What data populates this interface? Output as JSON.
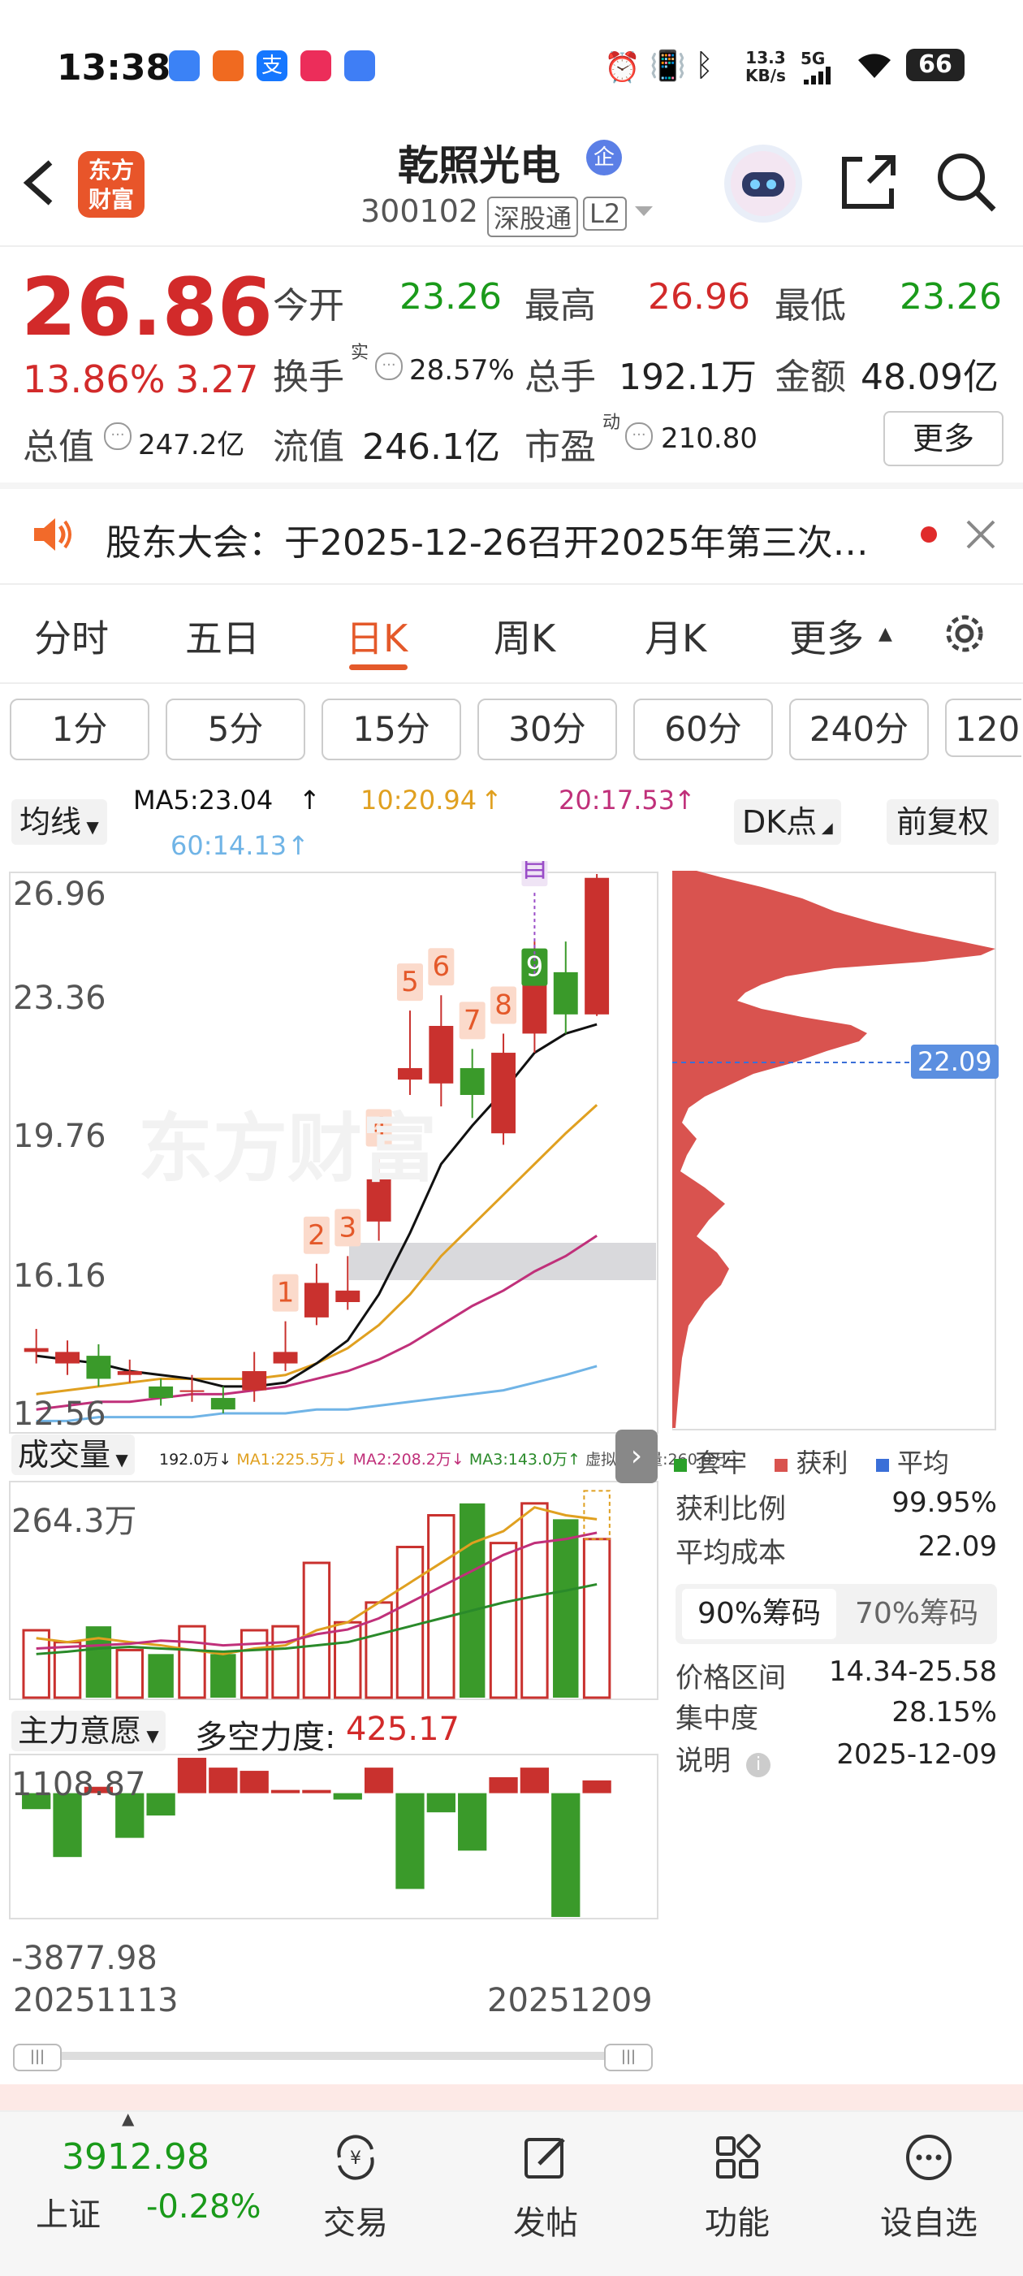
{
  "status": {
    "time": "13:38",
    "net_speed_top": "13.3",
    "net_speed_unit": "KB/s",
    "signal": "5G",
    "battery": "66",
    "app_icons": [
      "app-icon-blue",
      "app-icon-orange",
      "alipay-icon",
      "app-icon-pink",
      "app-icon-blue-q"
    ]
  },
  "header": {
    "back_icon": "chevron-left-icon",
    "brand_line1": "东方",
    "brand_line2": "财富",
    "title": "乾照光电",
    "title_badge": "企",
    "code": "300102",
    "market_tag": "深股通",
    "level_tag": "L2",
    "share_icon": "share-icon",
    "search_icon": "search-icon"
  },
  "quote": {
    "price": "26.86",
    "change_pct": "13.86%",
    "change_amt": "3.27",
    "open_label": "今开",
    "open": "23.26",
    "high_label": "最高",
    "high": "26.96",
    "low_label": "最低",
    "low": "23.26",
    "turnover_label": "换手",
    "turnover_sup": "实",
    "turnover": "28.57%",
    "volume_label": "总手",
    "volume": "192.1万",
    "amount_label": "金额",
    "amount": "48.09亿",
    "mktcap_label": "总值",
    "mktcap": "247.2亿",
    "float_label": "流值",
    "float": "246.1亿",
    "pe_label": "市盈",
    "pe_sup": "动",
    "pe": "210.80",
    "more_button": "更多"
  },
  "notice": {
    "text": "股东大会：于2025-12-26召开2025年第三次…"
  },
  "tabs": [
    "分时",
    "五日",
    "日K",
    "周K",
    "月K",
    "更多"
  ],
  "active_tab": "日K",
  "intervals": [
    "1分",
    "5分",
    "15分",
    "30分",
    "60分",
    "240分",
    "120"
  ],
  "ma_bar": {
    "selector": "均线",
    "ma5": "MA5:23.04",
    "ma10": "10:20.94",
    "ma20": "20:17.53",
    "ma60": "60:14.13",
    "dk_button": "DK点",
    "adjust_button": "前复权",
    "colors": {
      "ma5": "#111111",
      "ma10": "#e0a020",
      "ma20": "#c0307a",
      "ma60": "#70b4e6"
    }
  },
  "price_axis": [
    "26.96",
    "23.36",
    "19.76",
    "16.16",
    "12.56"
  ],
  "chip_marker": "22.09",
  "watermark": "东方财富",
  "chart_data": {
    "type": "candlestick",
    "date_range": [
      "20251113",
      "20251209"
    ],
    "ylim": [
      12.56,
      26.96
    ],
    "candles": [
      {
        "o": 14.5,
        "c": 14.6,
        "h": 15.1,
        "l": 14.2
      },
      {
        "o": 14.2,
        "c": 14.5,
        "h": 14.8,
        "l": 13.9
      },
      {
        "o": 14.4,
        "c": 13.8,
        "h": 14.7,
        "l": 13.6
      },
      {
        "o": 13.9,
        "c": 14.0,
        "h": 14.3,
        "l": 13.7
      },
      {
        "o": 13.6,
        "c": 13.3,
        "h": 13.8,
        "l": 13.1
      },
      {
        "o": 13.5,
        "c": 13.5,
        "h": 13.9,
        "l": 13.2
      },
      {
        "o": 13.3,
        "c": 13.0,
        "h": 13.6,
        "l": 12.9
      },
      {
        "o": 13.5,
        "c": 14.0,
        "h": 14.5,
        "l": 13.2
      },
      {
        "o": 14.2,
        "c": 14.5,
        "h": 15.3,
        "l": 14.0
      },
      {
        "o": 15.4,
        "c": 16.3,
        "h": 16.8,
        "l": 15.2
      },
      {
        "o": 15.8,
        "c": 16.1,
        "h": 17.0,
        "l": 15.6
      },
      {
        "o": 17.9,
        "c": 19.0,
        "h": 19.6,
        "l": 17.4
      },
      {
        "o": 21.6,
        "c": 21.9,
        "h": 23.4,
        "l": 21.2
      },
      {
        "o": 21.5,
        "c": 23.0,
        "h": 23.8,
        "l": 20.9
      },
      {
        "o": 21.9,
        "c": 21.2,
        "h": 22.4,
        "l": 20.6
      },
      {
        "o": 20.2,
        "c": 22.3,
        "h": 22.8,
        "l": 19.9
      },
      {
        "o": 22.8,
        "c": 24.3,
        "h": 25.2,
        "l": 22.3
      },
      {
        "o": 24.4,
        "c": 23.3,
        "h": 25.2,
        "l": 22.8
      },
      {
        "o": 23.3,
        "c": 26.86,
        "h": 26.96,
        "l": 23.26
      }
    ],
    "labels": [
      {
        "i": 8,
        "t": "1"
      },
      {
        "i": 9,
        "t": "2"
      },
      {
        "i": 10,
        "t": "3"
      },
      {
        "i": 11,
        "t": "4"
      },
      {
        "i": 12,
        "t": "5"
      },
      {
        "i": 13,
        "t": "6"
      },
      {
        "i": 14,
        "t": "7"
      },
      {
        "i": 15,
        "t": "8"
      },
      {
        "i": 16,
        "t": "9",
        "green": true
      },
      {
        "i": 16,
        "t": "自",
        "purple": true
      }
    ],
    "ma5": [
      14.4,
      14.3,
      14.2,
      14.0,
      13.9,
      13.8,
      13.6,
      13.6,
      13.7,
      14.2,
      14.8,
      16.0,
      17.6,
      19.4,
      20.4,
      21.3,
      22.3,
      22.8,
      23.04
    ],
    "ma10": [
      13.4,
      13.5,
      13.6,
      13.7,
      13.8,
      13.8,
      13.8,
      13.8,
      13.9,
      14.2,
      14.6,
      15.2,
      16.0,
      17.0,
      17.8,
      18.6,
      19.4,
      20.2,
      20.94
    ],
    "ma20": [
      13.0,
      13.1,
      13.2,
      13.2,
      13.3,
      13.4,
      13.4,
      13.5,
      13.6,
      13.8,
      14.0,
      14.3,
      14.7,
      15.2,
      15.7,
      16.1,
      16.6,
      17.0,
      17.53
    ],
    "ma60": [
      12.7,
      12.7,
      12.8,
      12.8,
      12.8,
      12.8,
      12.9,
      12.9,
      12.9,
      13.0,
      13.0,
      13.1,
      13.2,
      13.3,
      13.4,
      13.5,
      13.7,
      13.9,
      14.13
    ],
    "volume": {
      "selector": "成交量",
      "legend_vol": "192.0万",
      "legend_ma1": "MA1:225.5万",
      "legend_ma2": "MA2:208.2万",
      "legend_ma3": "MA3:143.0万",
      "legend_virtual": "虚拟成交量:260.9万",
      "max_label": "264.3万",
      "values": [
        85,
        70,
        90,
        60,
        55,
        90,
        55,
        85,
        90,
        170,
        95,
        120,
        190,
        230,
        245,
        195,
        245,
        225,
        200
      ],
      "max": 264.3
    },
    "flow": {
      "selector": "主力意愿",
      "title": "多空力度:",
      "value": "425.17",
      "top_label": "1108.87",
      "bottom_label": "-3877.98",
      "values": [
        -500,
        -2000,
        200,
        -1400,
        -700,
        1108,
        800,
        700,
        100,
        100,
        -200,
        800,
        -3000,
        -600,
        -1800,
        500,
        800,
        -3877,
        400
      ],
      "ylim": [
        -3877.98,
        1108.87
      ]
    }
  },
  "chip_panel": {
    "legend": [
      "套牢",
      "获利",
      "平均"
    ],
    "legend_colors": [
      "#2aa02a",
      "#d9534f",
      "#3a6fd8"
    ],
    "profit_ratio_label": "获利比例",
    "profit_ratio": "99.95%",
    "avg_cost_label": "平均成本",
    "avg_cost": "22.09",
    "tab_90": "90%筹码",
    "tab_70": "70%筹码",
    "range_label": "价格区间",
    "range": "14.34-25.58",
    "concentration_label": "集中度",
    "concentration": "28.15%",
    "note_label": "说明",
    "note_date": "2025-12-09"
  },
  "bottom_nav": {
    "index_value": "3912.98",
    "index_name": "上证",
    "index_change": "-0.28%",
    "items": [
      "交易",
      "发帖",
      "功能",
      "设自选"
    ]
  }
}
